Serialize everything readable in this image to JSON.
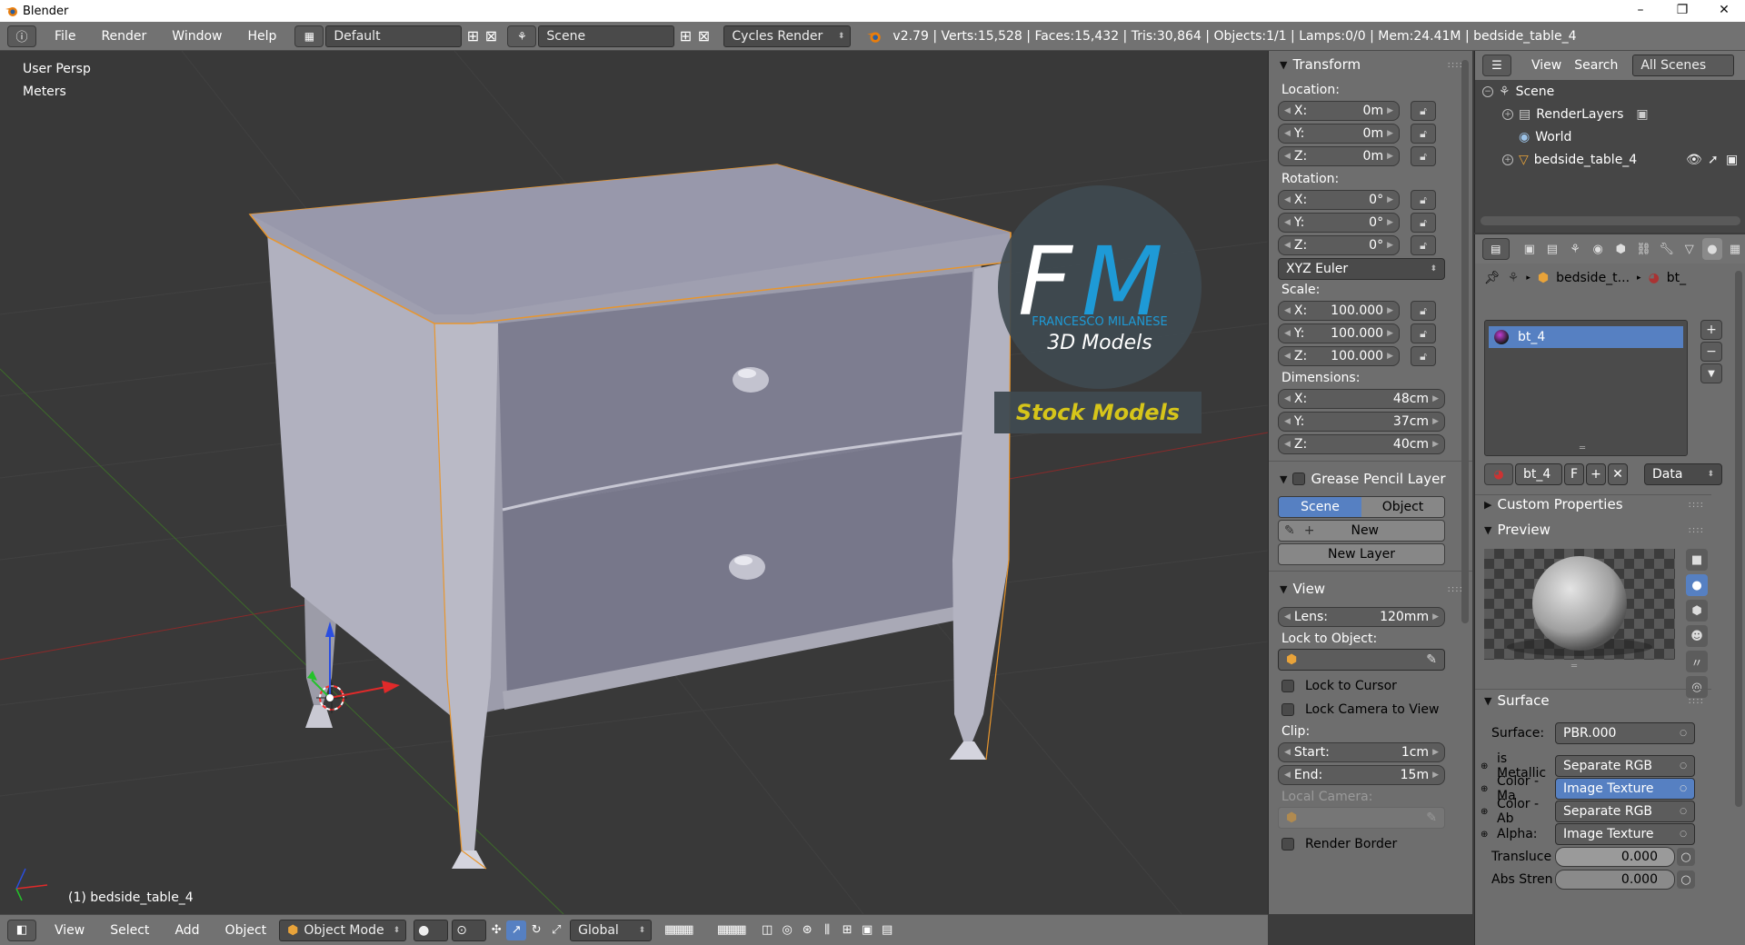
{
  "window": {
    "title": "Blender",
    "controls": [
      "–",
      "❐",
      "✕"
    ]
  },
  "info_header": {
    "menus": [
      "File",
      "Render",
      "Window",
      "Help"
    ],
    "screen_layout": "Default",
    "scene": "Scene",
    "render_engine": "Cycles Render",
    "stats": "v2.79 | Verts:15,528 | Faces:15,432 | Tris:30,864 | Objects:1/1 | Lamps:0/0 | Mem:24.41M | bedside_table_4"
  },
  "viewport": {
    "view_name": "User Persp",
    "units": "Meters",
    "selected_object": "(1) bedside_table_4",
    "watermark": {
      "logo_letters_1": "F",
      "logo_letters_2": "M",
      "author": "FRANCESCO MILANESE",
      "subtitle": "3D Models",
      "banner": "Stock Models"
    }
  },
  "transform_panel": {
    "title": "Transform",
    "location_label": "Location:",
    "location": [
      {
        "axis": "X:",
        "value": "0m"
      },
      {
        "axis": "Y:",
        "value": "0m"
      },
      {
        "axis": "Z:",
        "value": "0m"
      }
    ],
    "rotation_label": "Rotation:",
    "rotation": [
      {
        "axis": "X:",
        "value": "0°"
      },
      {
        "axis": "Y:",
        "value": "0°"
      },
      {
        "axis": "Z:",
        "value": "0°"
      }
    ],
    "rotation_mode": "XYZ Euler",
    "scale_label": "Scale:",
    "scale": [
      {
        "axis": "X:",
        "value": "100.000"
      },
      {
        "axis": "Y:",
        "value": "100.000"
      },
      {
        "axis": "Z:",
        "value": "100.000"
      }
    ],
    "dimensions_label": "Dimensions:",
    "dimensions": [
      {
        "axis": "X:",
        "value": "48cm"
      },
      {
        "axis": "Y:",
        "value": "37cm"
      },
      {
        "axis": "Z:",
        "value": "40cm"
      }
    ]
  },
  "grease_pencil_panel": {
    "title": "Grease Pencil Layer",
    "tabs": [
      "Scene",
      "Object"
    ],
    "active_tab": "Scene",
    "new_label": "New",
    "new_layer_label": "New Layer"
  },
  "view_panel": {
    "title": "View",
    "lens_label": "Lens:",
    "lens_value": "120mm",
    "lock_to_object_label": "Lock to Object:",
    "lock_to_cursor": "Lock to Cursor",
    "lock_camera_to_view": "Lock Camera to View",
    "clip_label": "Clip:",
    "clip_start_label": "Start:",
    "clip_start_value": "1cm",
    "clip_end_label": "End:",
    "clip_end_value": "15m",
    "local_camera_label": "Local Camera:",
    "render_border": "Render Border"
  },
  "outliner": {
    "menus": [
      "View",
      "Search"
    ],
    "filter": "All Scenes",
    "items": [
      {
        "label": "Scene"
      },
      {
        "label": "RenderLayers"
      },
      {
        "label": "World"
      },
      {
        "label": "bedside_table_4"
      }
    ]
  },
  "properties": {
    "breadcrumb_object": "bedside_t...",
    "breadcrumb_material": "bt_",
    "material_slot": "bt_4",
    "material_name": "bt_4",
    "material_fake_user": "F",
    "link_mode": "Data",
    "custom_properties": "Custom Properties",
    "preview": "Preview",
    "surface_section": "Surface",
    "surface_rows": [
      {
        "label": "Surface:",
        "value": "PBR.000"
      },
      {
        "label": "is Metallic",
        "value": "Separate RGB"
      },
      {
        "label": "Color - Ma",
        "value": "Image Texture"
      },
      {
        "label": "Color - Ab",
        "value": "Separate RGB"
      },
      {
        "label": "Alpha:",
        "value": "Image Texture"
      }
    ],
    "numeric_rows": [
      {
        "label": "Transluce",
        "value": "0.000"
      },
      {
        "label": "Abs Stren",
        "value": "0.000"
      }
    ]
  },
  "bottom_header": {
    "menus": [
      "View",
      "Select",
      "Add",
      "Object"
    ],
    "mode": "Object Mode",
    "orientation": "Global"
  },
  "colors": {
    "selection_outline": "#e8962e",
    "active_blue": "#5680c2",
    "logo_blue": "#1e9ad6",
    "banner_yellow": "#d6c51a"
  }
}
